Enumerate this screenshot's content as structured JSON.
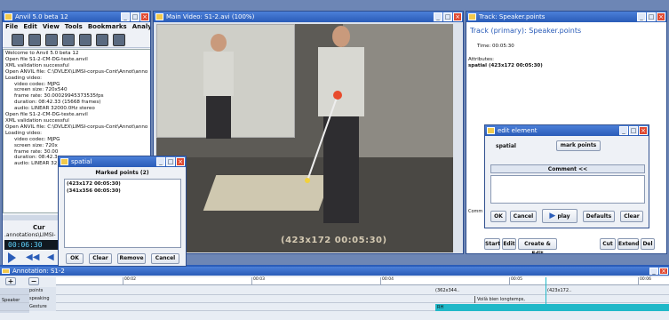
{
  "anvil": {
    "title": "Anvil 5.0 beta 12",
    "menu": [
      "File",
      "Edit",
      "View",
      "Tools",
      "Bookmarks",
      "Analysis",
      "?"
    ],
    "log": [
      "Welcome to Anvil 5.0 beta 12",
      "Open file S1-2-CM-DG-texte.anvil",
      "XML validation successful",
      "Open ANVIL file: C:\\DVLEX\\LIMSI-corpus-Cont\\Annot\\anno",
      "Loading video:",
      "video codec: MJPG",
      "screen size: 720x540",
      "frame rate: 30.00029945373535fps",
      "duration: 08:42.33 (15668 frames)",
      "audio: LINEAR 32000.0Hz stereo",
      "Open file S1-2-CM-DG-texte.anvil",
      "XML validation successful",
      "Open ANVIL file: C:\\DVLEX\\LIMSI-corpus-Cont\\Annot\\anno",
      "Loading video:",
      "video codec: MJPG",
      "screen size: 720x",
      "frame rate: 30.00",
      "duration: 08:42.3",
      "audio: LINEAR 32"
    ],
    "cur": "Cur",
    "annot": ".annotations\\LIMSI-",
    "time": "00:06:30"
  },
  "video": {
    "title": "Main Video: S1-2.avi (100%)",
    "subtitle": "(423x172 00:05:30)"
  },
  "track": {
    "title": "Track: Speaker.points",
    "heading": "Track (primary): Speaker.points",
    "time": "Time: 00:05:30",
    "attributes": "Attributes:",
    "spatial": "spatial  (423x172 00:05:30)",
    "comment": "Comm",
    "buttons": [
      "Start",
      "Edit",
      "Create & Edit",
      "Cut",
      "Extend",
      "Del"
    ]
  },
  "spatial": {
    "title": "spatial",
    "heading": "Marked points  (2)",
    "points": [
      "(423x172 00:05:30)",
      "(341x356 00:05:30)"
    ],
    "buttons": [
      "OK",
      "Clear",
      "Remove",
      "Cancel"
    ]
  },
  "edit": {
    "title": "edit element",
    "label": "spatial",
    "mark": "mark points",
    "comment": "Comment <<",
    "buttons": [
      "OK",
      "Cancel",
      "play",
      "Defaults",
      "Clear"
    ]
  },
  "annotation": {
    "title": "Annotation: S1-2",
    "ticks": [
      "00:02",
      "00:03",
      "00:04",
      "00:05",
      "00:06"
    ],
    "speaker": "Speaker",
    "rows": [
      "points",
      "speaking",
      "Gesture"
    ],
    "labels": {
      "p1": "(362x344..",
      "p2": "(423x172..",
      "speak": "Voilà bien longtemps,",
      "gest": "RH"
    }
  },
  "colors": {
    "titlebar": "#2a5cb8",
    "teal": "#20b8c8"
  }
}
